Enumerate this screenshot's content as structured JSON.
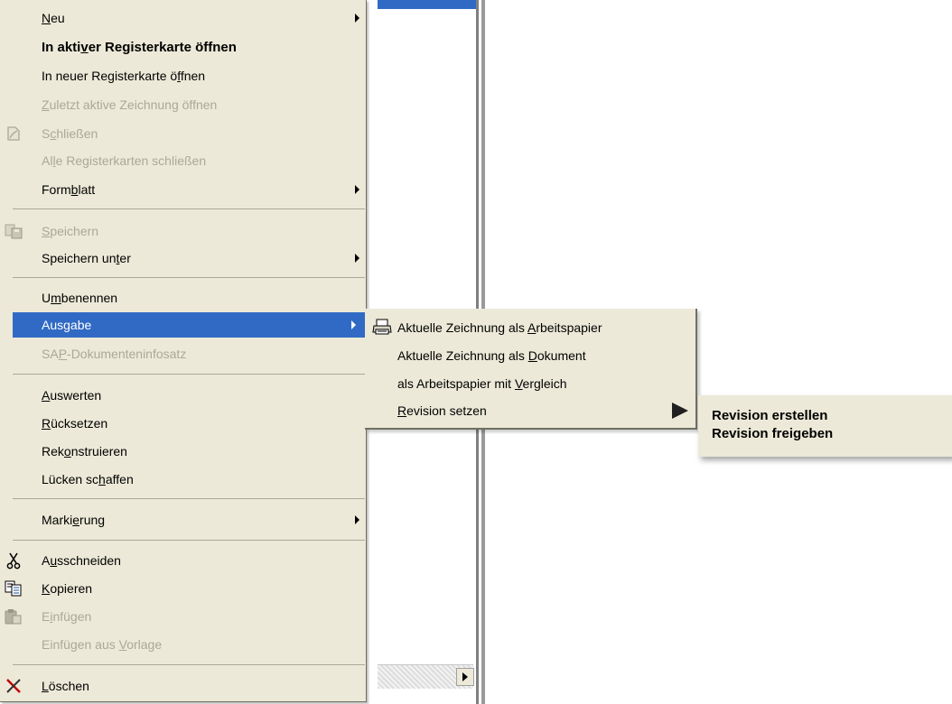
{
  "menu": {
    "items": [
      {
        "pre": "",
        "u": "N",
        "post": "eu",
        "state": "normal",
        "submenu": true,
        "icon": ""
      },
      {
        "pre": "In akti",
        "u": "v",
        "post": "er Registerkarte öffnen",
        "state": "bold",
        "submenu": false,
        "icon": ""
      },
      {
        "pre": "In neuer Registerkarte ö",
        "u": "f",
        "post": "fnen",
        "state": "normal",
        "submenu": false,
        "icon": ""
      },
      {
        "pre": "",
        "u": "Z",
        "post": "uletzt aktive Zeichnung öffnen",
        "state": "disabled",
        "submenu": false,
        "icon": ""
      },
      {
        "pre": "S",
        "u": "c",
        "post": "hließen",
        "state": "disabled",
        "submenu": false,
        "icon": "close-document-icon"
      },
      {
        "pre": "Al",
        "u": "l",
        "post": "e Registerkarten schließen",
        "state": "disabled",
        "submenu": false,
        "icon": ""
      },
      {
        "pre": "Form",
        "u": "b",
        "post": "latt",
        "state": "normal",
        "submenu": true,
        "icon": ""
      },
      {
        "pre": "",
        "u": "S",
        "post": "peichern",
        "state": "disabled",
        "submenu": false,
        "icon": "save-icon"
      },
      {
        "pre": "Speichern un",
        "u": "t",
        "post": "er",
        "state": "normal",
        "submenu": true,
        "icon": ""
      },
      {
        "pre": "U",
        "u": "m",
        "post": "benennen",
        "state": "normal",
        "submenu": false,
        "icon": ""
      },
      {
        "pre": "Aus",
        "u": "g",
        "post": "abe",
        "state": "selected",
        "submenu": true,
        "icon": ""
      },
      {
        "pre": "SA",
        "u": "P",
        "post": "-Dokumenteninfosatz",
        "state": "disabled",
        "submenu": false,
        "icon": ""
      },
      {
        "pre": "",
        "u": "A",
        "post": "uswerten",
        "state": "normal",
        "submenu": false,
        "icon": ""
      },
      {
        "pre": "",
        "u": "R",
        "post": "ücksetzen",
        "state": "normal",
        "submenu": false,
        "icon": ""
      },
      {
        "pre": "Rek",
        "u": "o",
        "post": "nstruieren",
        "state": "normal",
        "submenu": false,
        "icon": ""
      },
      {
        "pre": "Lücken sc",
        "u": "h",
        "post": "affen",
        "state": "normal",
        "submenu": false,
        "icon": ""
      },
      {
        "pre": "Marki",
        "u": "e",
        "post": "rung",
        "state": "normal",
        "submenu": true,
        "icon": ""
      },
      {
        "pre": "A",
        "u": "u",
        "post": "sschneiden",
        "state": "normal",
        "submenu": false,
        "icon": "scissors-icon"
      },
      {
        "pre": "",
        "u": "K",
        "post": "opieren",
        "state": "normal",
        "submenu": false,
        "icon": "copy-icon"
      },
      {
        "pre": "E",
        "u": "i",
        "post": "nfügen",
        "state": "disabled",
        "submenu": false,
        "icon": "paste-icon"
      },
      {
        "pre": "Einfügen aus ",
        "u": "V",
        "post": "orlage",
        "state": "disabled",
        "submenu": false,
        "icon": ""
      },
      {
        "pre": "",
        "u": "L",
        "post": "öschen",
        "state": "normal",
        "submenu": false,
        "icon": "delete-x-icon"
      }
    ]
  },
  "submenu_ausgabe": {
    "items": [
      {
        "pre": "Aktuelle Zeichnung als ",
        "u": "A",
        "post": "rbeitspapier",
        "icon": "printer-icon"
      },
      {
        "pre": "Aktuelle Zeichnung als ",
        "u": "D",
        "post": "okument",
        "icon": ""
      },
      {
        "pre": "als Arbeitspapier mit ",
        "u": "V",
        "post": "ergleich",
        "icon": ""
      },
      {
        "pre": "",
        "u": "R",
        "post": "evision setzen",
        "icon": ""
      }
    ]
  },
  "popup_revision": {
    "items": [
      "Revision erstellen",
      "Revision freigeben"
    ]
  },
  "colors": {
    "menu_bg": "#ece9d8",
    "highlight": "#316ac5",
    "disabled_text": "#aca899"
  }
}
